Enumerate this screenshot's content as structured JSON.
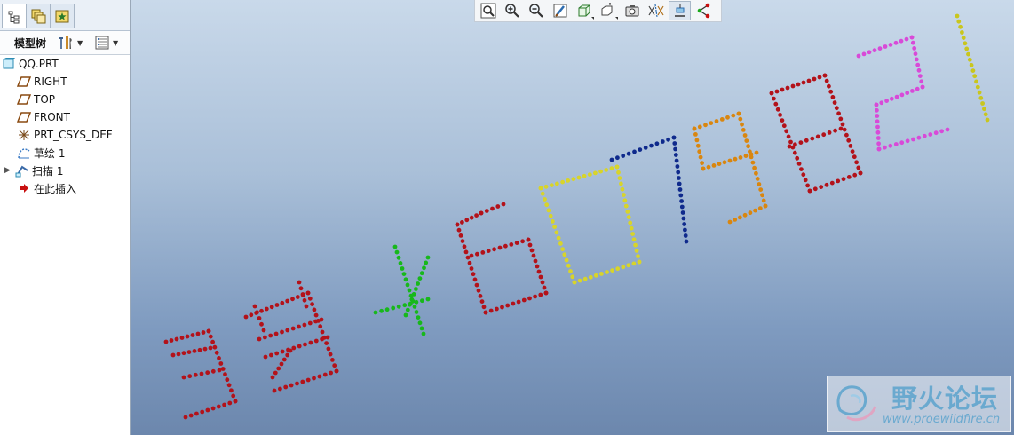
{
  "sidebar": {
    "tabs": [
      {
        "name": "model-tree-tab-icon"
      },
      {
        "name": "layers-tab-icon"
      },
      {
        "name": "favorites-tab-icon"
      }
    ],
    "header": {
      "title": "模型树",
      "settings_icon": "tools-icon",
      "show_icon": "tree-columns-icon"
    },
    "tree": [
      {
        "label": "QQ.PRT",
        "icon": "part-icon"
      },
      {
        "label": "RIGHT",
        "icon": "datum-plane-icon"
      },
      {
        "label": "TOP",
        "icon": "datum-plane-icon"
      },
      {
        "label": "FRONT",
        "icon": "datum-plane-icon"
      },
      {
        "label": "PRT_CSYS_DEF",
        "icon": "coordinate-system-icon"
      },
      {
        "label": "草绘 1",
        "icon": "sketch-icon"
      },
      {
        "label": "扫描 1",
        "icon": "sweep-icon"
      },
      {
        "label": "在此插入",
        "icon": "insert-here-arrow-icon"
      }
    ]
  },
  "toolbar": {
    "buttons": [
      {
        "name": "refit-icon"
      },
      {
        "name": "zoom-in-icon"
      },
      {
        "name": "zoom-out-icon"
      },
      {
        "name": "repaint-icon"
      },
      {
        "name": "display-style-icon"
      },
      {
        "name": "saved-views-icon"
      },
      {
        "name": "view-manager-icon"
      },
      {
        "name": "datum-display-icon"
      },
      {
        "name": "annotation-display-icon"
      },
      {
        "name": "spin-center-icon"
      }
    ]
  },
  "colors": {
    "red": "#b3121a",
    "green": "#17b81b",
    "yellow": "#d8d42a",
    "navy": "#0f2a8c",
    "orange": "#d9860f",
    "magenta": "#d84ad8",
    "olive": "#c9c61e"
  },
  "watermark": {
    "name": "野火论坛",
    "url": "www.proewildfire.cn"
  }
}
